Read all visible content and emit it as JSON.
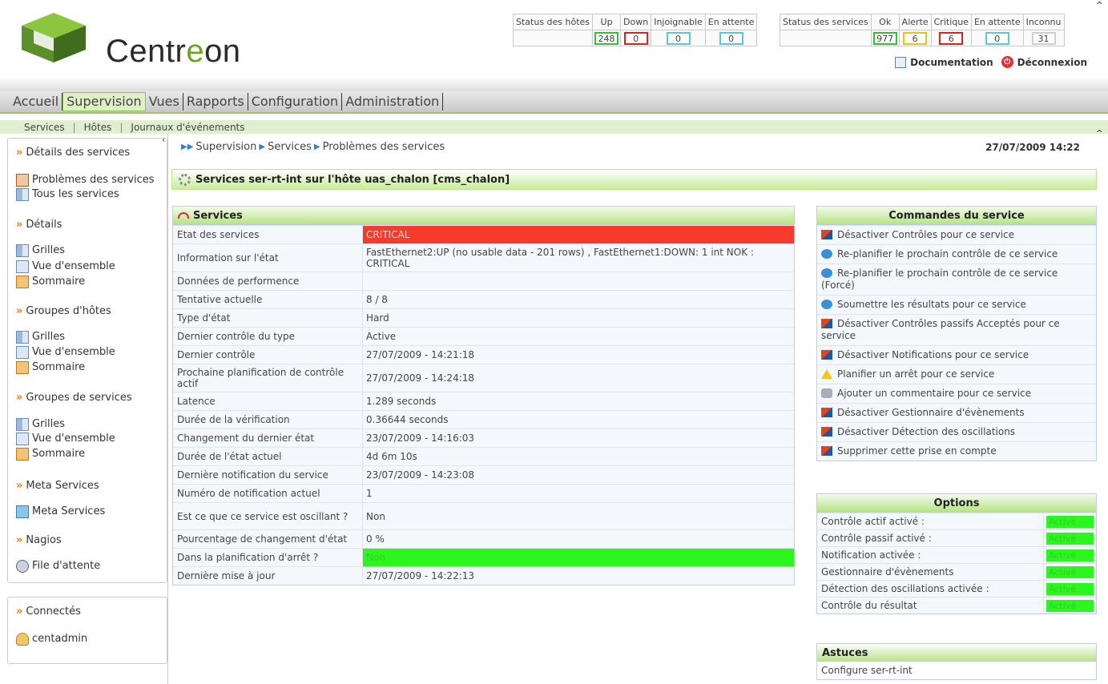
{
  "logo": {
    "text_prefix": "Centr",
    "text_e": "e",
    "text_suffix": "on"
  },
  "host_status": {
    "headers": [
      "Status des hôtes",
      "Up",
      "Down",
      "Injoignable",
      "En attente"
    ],
    "values": [
      "248",
      "0",
      "0",
      "0"
    ],
    "colors": [
      "#33c133",
      "#e02020",
      "#5bc6d6",
      "#5bc6d6"
    ]
  },
  "service_status": {
    "headers": [
      "Status des services",
      "Ok",
      "Alerte",
      "Critique",
      "En attente",
      "Inconnu"
    ],
    "values": [
      "977",
      "6",
      "6",
      "0",
      "31"
    ],
    "colors": [
      "#33c133",
      "#f0c01a",
      "#e02020",
      "#5bc6d6",
      "#cfcfcf"
    ]
  },
  "toplinks": {
    "documentation": "Documentation",
    "logout": "Déconnexion"
  },
  "menu": [
    "Accueil",
    "Supervision",
    "Vues",
    "Rapports",
    "Configuration",
    "Administration"
  ],
  "menu_active": "Supervision",
  "submenu": [
    "Services",
    "Hôtes",
    "Journaux d'événements"
  ],
  "sidebar": {
    "sections": [
      {
        "title": "Détails des services",
        "items": [
          "Problèmes des services",
          "Tous les services"
        ]
      },
      {
        "title": "Détails",
        "items": [
          "Grilles",
          "Vue d'ensemble",
          "Sommaire"
        ]
      },
      {
        "title": "Groupes d'hôtes",
        "items": [
          "Grilles",
          "Vue d'ensemble",
          "Sommaire"
        ]
      },
      {
        "title": "Groupes de services",
        "items": [
          "Grilles",
          "Vue d'ensemble",
          "Sommaire"
        ]
      },
      {
        "title": "Meta Services",
        "items": [
          "Meta Services"
        ]
      },
      {
        "title": "Nagios",
        "items": [
          "File d'attente"
        ]
      }
    ],
    "connected_title": "Connectés",
    "connected_user": "centadmin"
  },
  "breadcrumb": [
    "Supervision",
    "Services",
    "Problèmes des services"
  ],
  "datetime": "27/07/2009 14:22",
  "page_title": "Services ser-rt-int sur l'hôte uas_chalon [cms_chalon]",
  "services_panel": {
    "title": "Services",
    "rows": [
      {
        "k": "Etat des services",
        "v": "CRITICAL"
      },
      {
        "k": "Information sur l'état",
        "v": "FastEthernet2:UP (no usable data - 201 rows) , FastEthernet1:DOWN: 1 int NOK : CRITICAL"
      },
      {
        "k": "Données de performence",
        "v": ""
      },
      {
        "k": "Tentative actuelle",
        "v": "8 / 8"
      },
      {
        "k": "Type d'état",
        "v": "Hard"
      },
      {
        "k": "Dernier contrôle du type",
        "v": "Active"
      },
      {
        "k": "Dernier contrôle",
        "v": "27/07/2009 - 14:21:18"
      },
      {
        "k": "Prochaine planification de contrôle actif",
        "v": "27/07/2009 - 14:24:18"
      },
      {
        "k": "Latence",
        "v": "1.289 seconds"
      },
      {
        "k": "Durée de la vérification",
        "v": "0.36644 seconds"
      },
      {
        "k": "Changement du dernier état",
        "v": "23/07/2009 - 14:16:03"
      },
      {
        "k": "Durée de l'état actuel",
        "v": "4d 6m 10s"
      },
      {
        "k": "Dernière notification du service",
        "v": "23/07/2009 - 14:23:08"
      },
      {
        "k": "Numéro de notification actuel",
        "v": "1"
      },
      {
        "k": "Est ce que ce service est oscillant ?",
        "v": "Non"
      },
      {
        "k": "Pourcentage de changement d'état",
        "v": "0 %"
      },
      {
        "k": "Dans la planification d'arrêt ?",
        "v": "Non"
      },
      {
        "k": "Dernière mise à jour",
        "v": "27/07/2009 - 14:22:13"
      }
    ]
  },
  "commands_panel": {
    "title": "Commandes du service",
    "items": [
      "Désactiver Contrôles pour ce service",
      "Re-planifier le prochain contrôle de ce service",
      "Re-planifier le prochain contrôle de ce service (Forcé)",
      "Soumettre les résultats pour ce service",
      "Désactiver Contrôles passifs Acceptés pour ce service",
      "Désactiver Notifications pour ce service",
      "Planifier un arrêt pour ce service",
      "Ajouter un commentaire pour ce service",
      "Désactiver Gestionnaire d'évènements",
      "Désactiver Détection des oscillations",
      "Supprimer cette prise en compte"
    ]
  },
  "options_panel": {
    "title": "Options",
    "rows": [
      {
        "k": "Contrôle actif activé :",
        "v": "Activé"
      },
      {
        "k": "Contrôle passif activé :",
        "v": "Activé"
      },
      {
        "k": "Notification activée :",
        "v": "Activé"
      },
      {
        "k": "Gestionnaire d'évènements",
        "v": "Activé"
      },
      {
        "k": "Détection des oscillations activée :",
        "v": "Activé"
      },
      {
        "k": "Contrôle du résultat",
        "v": "Activé"
      }
    ]
  },
  "tips_panel": {
    "title": "Astuces",
    "text": "Configure ser-rt-int"
  }
}
